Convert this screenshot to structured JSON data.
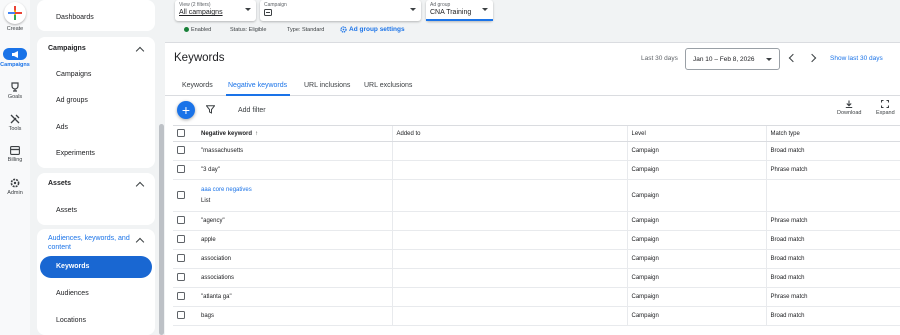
{
  "rail": {
    "create": "Create",
    "campaigns": "Campaigns",
    "goals": "Goals",
    "tools": "Tools",
    "billing": "Billing",
    "admin": "Admin"
  },
  "sidebar": {
    "dashboards": "Dashboards",
    "campaigns_header": "Campaigns",
    "campaigns_items": [
      "Campaigns",
      "Ad groups",
      "Ads",
      "Experiments"
    ],
    "assets_header": "Assets",
    "assets_items": [
      "Assets"
    ],
    "audiences_header": "Audiences, keywords, and content",
    "audiences_items": [
      "Keywords",
      "Audiences",
      "Locations"
    ],
    "active_item": "Keywords"
  },
  "topbar": {
    "view_label": "View (2 filters)",
    "view_value": "All campaigns",
    "campaign_label": "Campaign",
    "adgroup_label": "Ad group",
    "adgroup_value": "CNA Training",
    "status_enabled": "Enabled",
    "status_text": "Status: Eligible",
    "type_text": "Type: Standard",
    "settings_link": "Ad group settings"
  },
  "page": {
    "title": "Keywords",
    "date_label": "Last 30 days",
    "date_range": "Jan 10 – Feb 8, 2026",
    "show_last": "Show last 30 days"
  },
  "tabs": [
    "Keywords",
    "Negative keywords",
    "URL inclusions",
    "URL exclusions"
  ],
  "active_tab": "Negative keywords",
  "toolbar": {
    "add_filter": "Add filter",
    "download": "Download",
    "expand": "Expand"
  },
  "table": {
    "headers": {
      "keyword": "Negative keyword",
      "added_to": "Added to",
      "level": "Level",
      "match_type": "Match type"
    },
    "rows": [
      {
        "keyword": "\"massachusetts",
        "level": "Campaign",
        "match": "Broad match"
      },
      {
        "keyword": "\"3 day\"",
        "level": "Campaign",
        "match": "Phrase match"
      },
      {
        "keyword": "aaa core negatives",
        "sub": "List",
        "level": "Campaign",
        "match": ""
      },
      {
        "keyword": "\"agency\"",
        "level": "Campaign",
        "match": "Phrase match"
      },
      {
        "keyword": "apple",
        "level": "Campaign",
        "match": "Broad match"
      },
      {
        "keyword": "association",
        "level": "Campaign",
        "match": "Broad match"
      },
      {
        "keyword": "associations",
        "level": "Campaign",
        "match": "Broad match"
      },
      {
        "keyword": "\"atlanta ga\"",
        "level": "Campaign",
        "match": "Phrase match"
      },
      {
        "keyword": "bags",
        "level": "Campaign",
        "match": "Broad match"
      }
    ]
  },
  "colors": {
    "accent": "#1a73e8",
    "active_nav": "#1967d2",
    "enabled": "#188038"
  }
}
